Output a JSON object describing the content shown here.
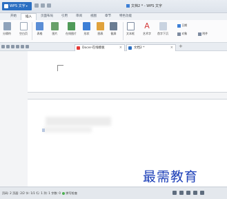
{
  "app": {
    "name": "WPS 文字",
    "document_title": "文档2 * - WPS 文字"
  },
  "menu": {
    "tabs": [
      "开始",
      "插入",
      "页面布局",
      "引用",
      "审阅",
      "视图",
      "章节",
      "特色功能"
    ],
    "active": "插入"
  },
  "ribbon": {
    "buttons": [
      "分隔符",
      "空白页",
      "表格",
      "图片",
      "在线图片",
      "形状",
      "图表",
      "截屏",
      "文本框",
      "艺术字",
      "首字下沉",
      "日期",
      "对象",
      "附件"
    ]
  },
  "doc_tabs": [
    {
      "label": "Docer-在线模板",
      "icon_color": "#e53935"
    },
    {
      "label": "文档2 *",
      "icon_color": "#2b6fc2"
    }
  ],
  "status": {
    "text": "页码: 2  页面: 2/2  节: 1/1  行: 1  列: 1  字数: 0",
    "spellcheck": "拼写检查"
  },
  "watermark": "最需教育",
  "colors": {
    "accent": "#2b6fc2",
    "watermark": "#1c3fb8"
  }
}
